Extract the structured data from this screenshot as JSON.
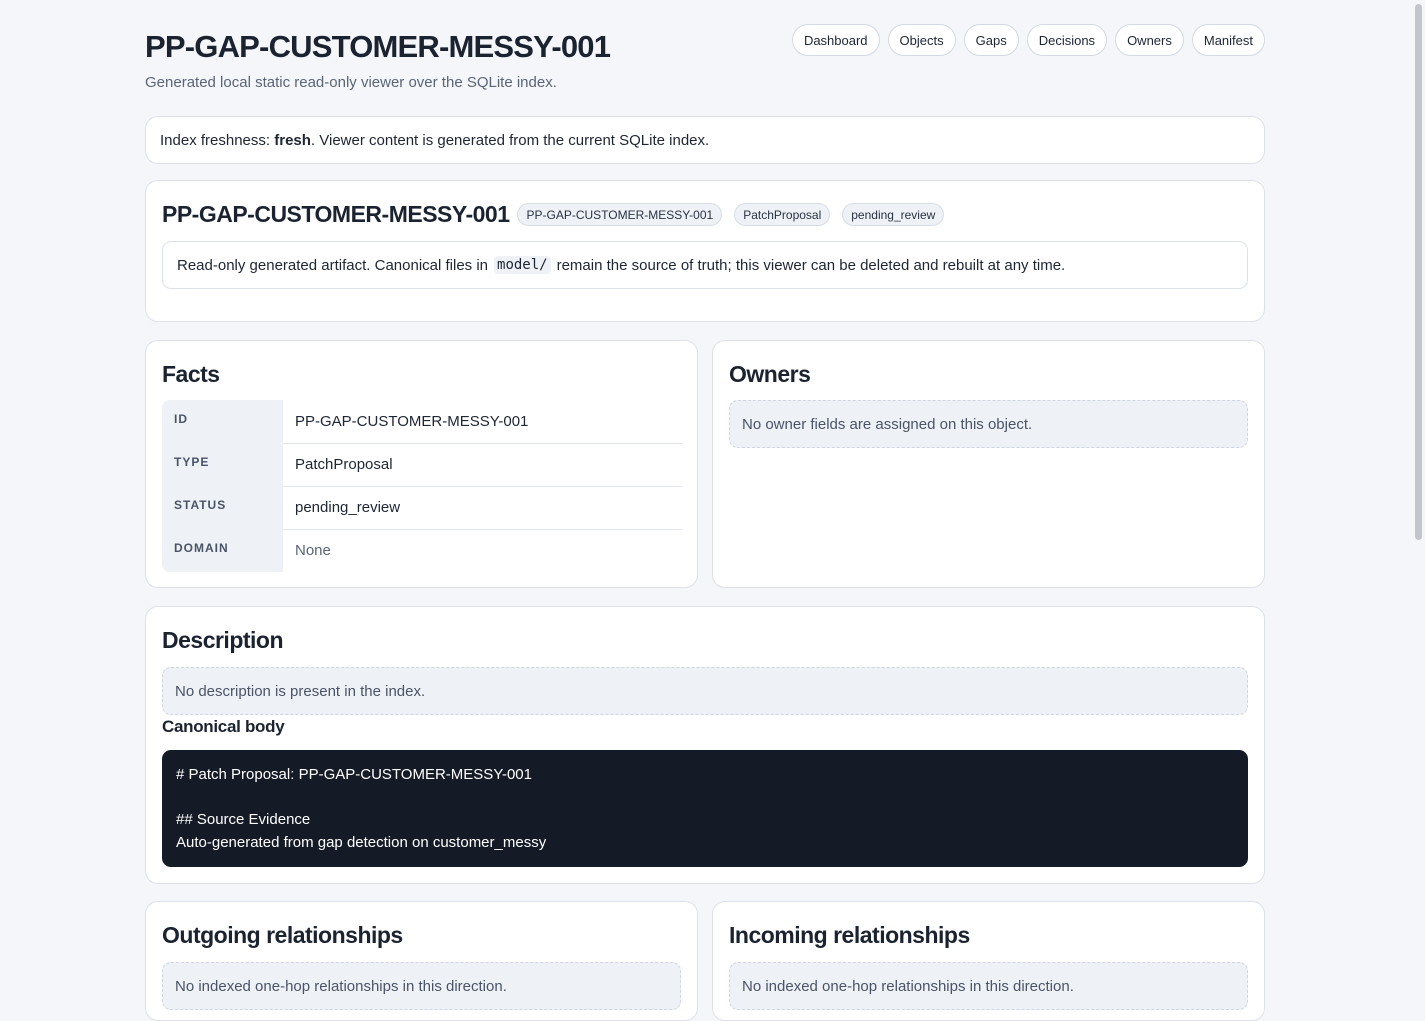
{
  "header": {
    "title": "PP-GAP-CUSTOMER-MESSY-001",
    "subtitle": "Generated local static read-only viewer over the SQLite index."
  },
  "nav": [
    "Dashboard",
    "Objects",
    "Gaps",
    "Decisions",
    "Owners",
    "Manifest"
  ],
  "freshness": {
    "prefix": "Index freshness: ",
    "state": "fresh",
    "suffix": ". Viewer content is generated from the current SQLite index."
  },
  "object": {
    "title": "PP-GAP-CUSTOMER-MESSY-001",
    "badges": [
      "PP-GAP-CUSTOMER-MESSY-001",
      "PatchProposal",
      "pending_review"
    ],
    "notice_before": "Read-only generated artifact. Canonical files in",
    "notice_code": "model/",
    "notice_after": "remain the source of truth; this viewer can be deleted and rebuilt at any time."
  },
  "facts": {
    "title": "Facts",
    "rows": [
      {
        "key": "ID",
        "value": "PP-GAP-CUSTOMER-MESSY-001"
      },
      {
        "key": "TYPE",
        "value": "PatchProposal"
      },
      {
        "key": "STATUS",
        "value": "pending_review"
      },
      {
        "key": "DOMAIN",
        "value": "None"
      }
    ]
  },
  "owners": {
    "title": "Owners",
    "empty": "No owner fields are assigned on this object."
  },
  "description": {
    "title": "Description",
    "empty": "No description is present in the index.",
    "canonical_title": "Canonical body",
    "body_lines": [
      "# Patch Proposal: PP-GAP-CUSTOMER-MESSY-001",
      "",
      "## Source Evidence",
      "Auto-generated from gap detection on customer_messy"
    ]
  },
  "outgoing": {
    "title": "Outgoing relationships",
    "empty": "No indexed one-hop relationships in this direction."
  },
  "incoming": {
    "title": "Incoming relationships",
    "empty": "No indexed one-hop relationships in this direction."
  }
}
